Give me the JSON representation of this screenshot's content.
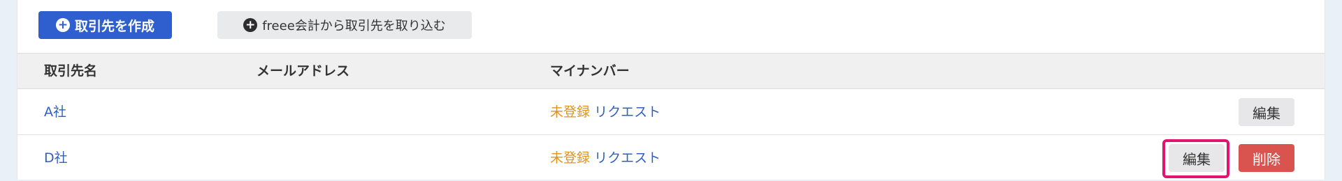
{
  "toolbar": {
    "create_label": "取引先を作成",
    "import_label": "freee会計から取引先を取り込む"
  },
  "table": {
    "headers": [
      "取引先名",
      "メールアドレス",
      "マイナンバー"
    ],
    "rows": [
      {
        "name": "A社",
        "email": "",
        "mynumber_status": "未登録",
        "request": "リクエスト",
        "edit": "編集"
      },
      {
        "name": "D社",
        "email": "",
        "mynumber_status": "未登録",
        "request": "リクエスト",
        "edit": "編集",
        "delete": "削除"
      }
    ]
  },
  "icons": {
    "create": "plus-circle-icon",
    "import": "plus-circle-icon"
  },
  "colors": {
    "primary": "#2f5fcf",
    "link": "#2f5fbf",
    "status_unregistered": "#e0921f",
    "danger": "#d9534f",
    "highlight": "#e2146f"
  }
}
